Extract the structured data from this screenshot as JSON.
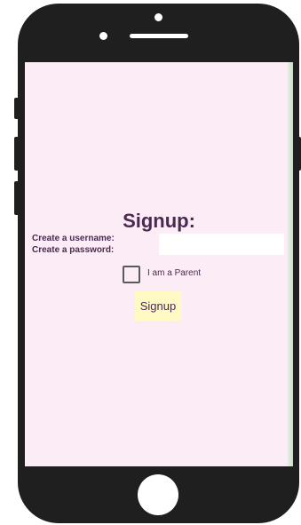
{
  "colors": {
    "device_frame": "#1f1f1f",
    "screen_background": "#fcecf6",
    "text": "#4a2a52",
    "button_background": "#fff9c4",
    "input_background": "#ffffff"
  },
  "form": {
    "title": "Signup:",
    "username_label": "Create a username:",
    "password_label": "Create a password:",
    "input_value": "",
    "parent_checkbox_label": "I am a Parent",
    "parent_checkbox_checked": false,
    "submit_label": "Signup"
  },
  "icons": {
    "home_button": "home-button-circle",
    "camera": "camera-dot",
    "speaker": "speaker-slot"
  }
}
